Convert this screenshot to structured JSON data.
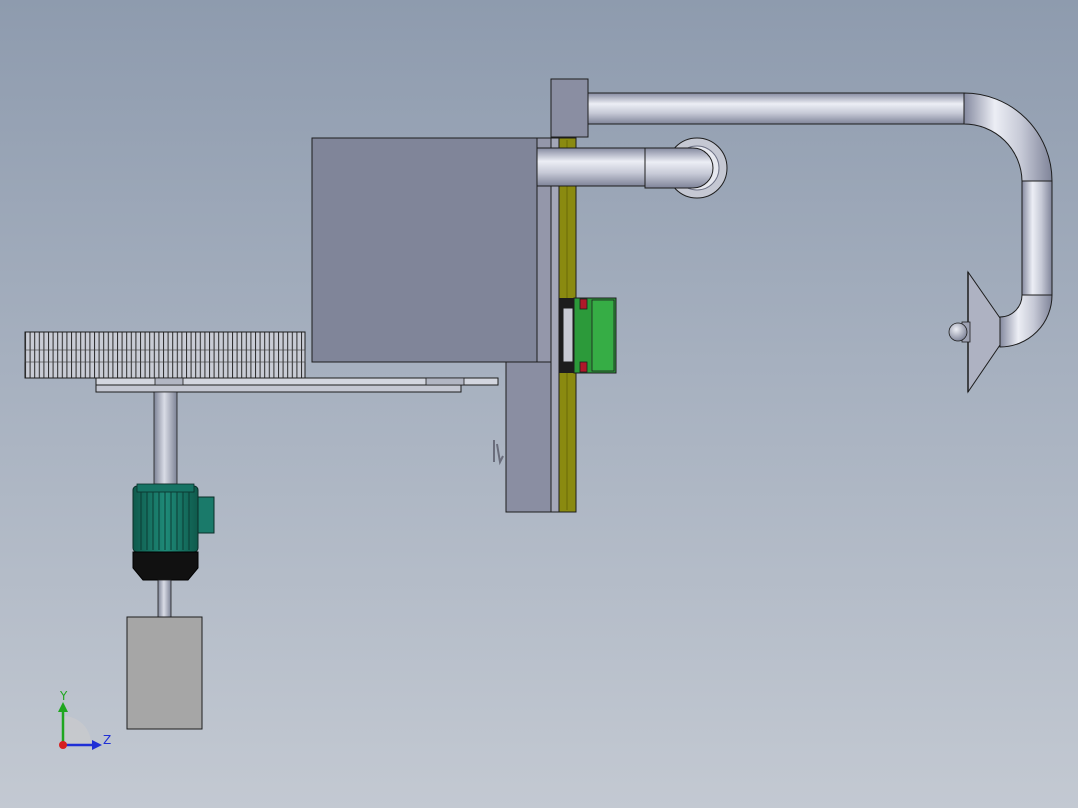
{
  "view": {
    "background_top": "#8e9bae",
    "background_bottom": "#c3c9d2"
  },
  "triad": {
    "y_label": "Y",
    "z_label": "Z",
    "y_color": "#1fa61f",
    "z_color": "#1f2fd6",
    "x_color": "#d61f1f"
  },
  "colors": {
    "housing": "#808599",
    "panel": "#9497aa",
    "rail": "#8a8a10",
    "slider": "#2c9a3a",
    "slider_stop": "#b0182a",
    "motor": "#1a7a6a",
    "motor_base": "#111111",
    "gear": "#b6b9c3",
    "block": "#a6a6a6",
    "pipe_light": "#eceef5",
    "pipe_dark": "#858aa0"
  }
}
